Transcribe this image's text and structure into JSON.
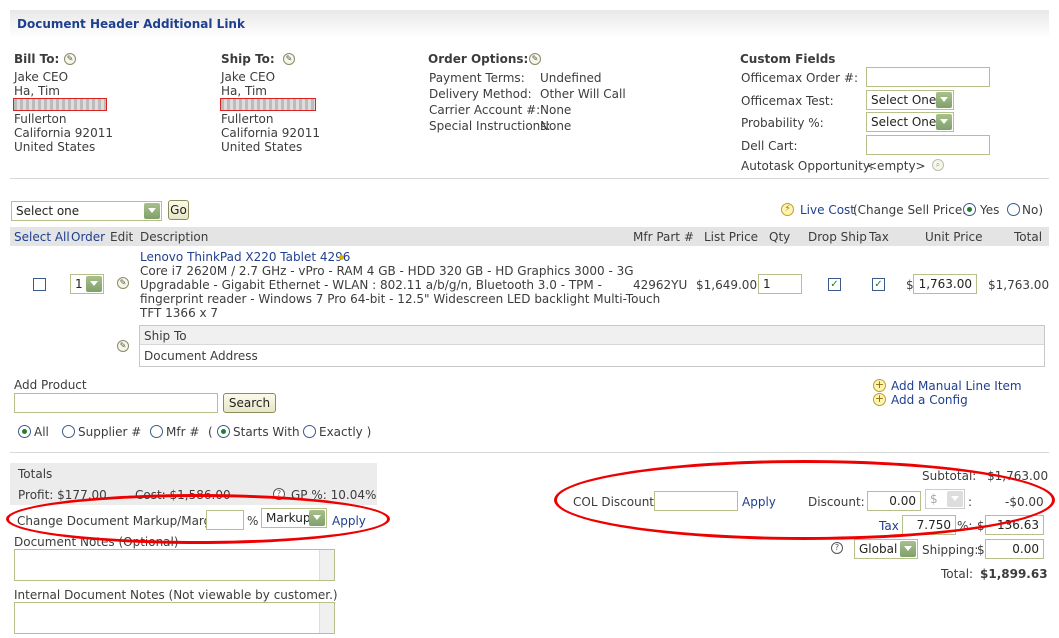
{
  "header": {
    "title": "Document Header Additional Link"
  },
  "bill_to": {
    "label": "Bill To:",
    "lines": [
      "Jake CEO",
      "Ha, Tim",
      "Fullerton",
      "California 92011",
      "United States"
    ]
  },
  "ship_to": {
    "label": "Ship To:",
    "lines": [
      "Jake CEO",
      "Ha, Tim",
      "Fullerton",
      "California 92011",
      "United States"
    ]
  },
  "order_options": {
    "label": "Order Options:",
    "rows": [
      {
        "k": "Payment Terms:",
        "v": "Undefined"
      },
      {
        "k": "Delivery Method:",
        "v": "Other Will Call"
      },
      {
        "k": "Carrier Account #:",
        "v": "None"
      },
      {
        "k": "Special Instructions:",
        "v": "None"
      }
    ]
  },
  "custom_fields": {
    "label": "Custom Fields",
    "officemax_order": "Officemax Order #:",
    "officemax_test": "Officemax Test:",
    "officemax_test_value": "Select One",
    "probability": "Probability %:",
    "probability_value": "Select One",
    "dell_cart": "Dell Cart:",
    "autotask": "Autotask Opportunity:",
    "autotask_value": "<empty>"
  },
  "actions": {
    "select_value": "Select one",
    "go": "Go"
  },
  "live_cost": {
    "label": "Live Cost",
    "change_sell": "(Change Sell Price:",
    "yes": "Yes",
    "no": "No)"
  },
  "table": {
    "headers": {
      "select_all": "Select All",
      "order": "Order",
      "edit": "Edit",
      "description": "Description",
      "mfr": "Mfr Part #",
      "list": "List Price",
      "qty": "Qty",
      "drop": "Drop Ship",
      "tax": "Tax",
      "unit": "Unit Price",
      "total": "Total"
    },
    "row": {
      "order": "1",
      "title": "Lenovo ThinkPad X220 Tablet 4296",
      "desc": [
        "Core i7 2620M / 2.7 GHz - vPro - RAM 4 GB - HDD 320 GB - HD Graphics 3000 - 3G",
        "Upgradable - Gigabit Ethernet - WLAN : 802.11 a/b/g/n, Bluetooth 3.0 - TPM -",
        "fingerprint reader - Windows 7 Pro 64-bit - 12.5\" Widescreen LED backlight Multi-Touch",
        "TFT 1366 x 7"
      ],
      "mfr": "42962YU",
      "list": "$1,649.00",
      "qty": "1",
      "currency": "$",
      "unit": "1,763.00",
      "total": "$1,763.00"
    },
    "ship_to_label": "Ship To",
    "doc_address": "Document Address"
  },
  "add_product": {
    "label": "Add Product",
    "search": "Search",
    "add_manual": "Add Manual Line Item",
    "add_config": "Add a Config",
    "filters": {
      "all": "All",
      "supplier": "Supplier #",
      "mfr": "Mfr #",
      "open": "(",
      "starts": "Starts With",
      "exactly": "Exactly )"
    }
  },
  "totals": {
    "label": "Totals",
    "profit": "Profit: $177.00",
    "cost": "Cost: $1,586.00",
    "gp": "GP %: 10.04%",
    "markup_label": "Change Document Markup/Margin",
    "pct": "%",
    "markup_value": "Markup",
    "apply": "Apply",
    "notes": "Document Notes (Optional)",
    "internal_notes": "Internal Document Notes (Not viewable by customer.)"
  },
  "summary": {
    "subtotal_label": "Subtotal:",
    "subtotal": "$1,763.00",
    "col_discount": "COL Discount:",
    "apply": "Apply",
    "discount_label": "Discount:",
    "discount": "0.00",
    "discount_unit": "$",
    "discount_colon": ":",
    "discount_result": "-$0.00",
    "tax_label": "Tax",
    "tax_rate": "7.750",
    "tax_pct": "%:",
    "tax_currency": "$",
    "tax_value": "136.63",
    "shipping_mode": "Global",
    "shipping_label": "Shipping:",
    "shipping_currency": "$",
    "shipping_value": "0.00",
    "total_label": "Total:",
    "total": "$1,899.63"
  }
}
